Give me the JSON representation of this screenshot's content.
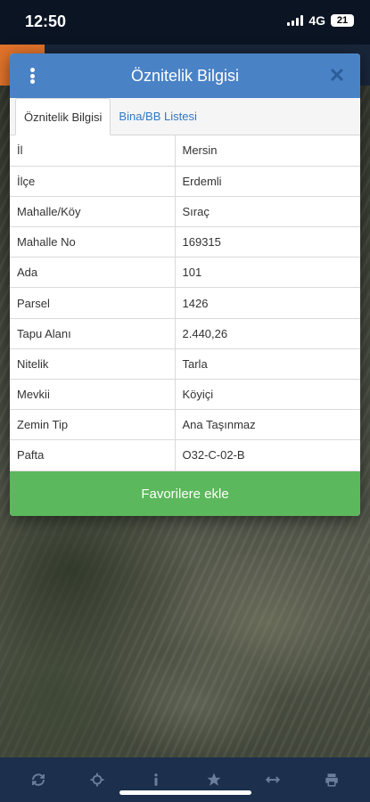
{
  "status": {
    "time": "12:50",
    "network": "4G",
    "battery": "21"
  },
  "modal": {
    "title": "Öznitelik Bilgisi",
    "tabs": [
      {
        "label": "Öznitelik Bilgisi",
        "active": true
      },
      {
        "label": "Bina/BB Listesi",
        "active": false
      }
    ],
    "rows": [
      {
        "key": "İl",
        "value": "Mersin"
      },
      {
        "key": "İlçe",
        "value": "Erdemli"
      },
      {
        "key": "Mahalle/Köy",
        "value": "Sıraç"
      },
      {
        "key": "Mahalle No",
        "value": "169315"
      },
      {
        "key": "Ada",
        "value": "101"
      },
      {
        "key": "Parsel",
        "value": "1426"
      },
      {
        "key": "Tapu Alanı",
        "value": "2.440,26"
      },
      {
        "key": "Nitelik",
        "value": "Tarla"
      },
      {
        "key": "Mevkii",
        "value": "Köyiçi"
      },
      {
        "key": "Zemin Tip",
        "value": "Ana Taşınmaz"
      },
      {
        "key": "Pafta",
        "value": "O32-C-02-B"
      }
    ],
    "favorite_label": "Favorilere ekle"
  },
  "toolbar": {
    "icons": [
      "refresh-icon",
      "crosshair-icon",
      "info-icon",
      "star-icon",
      "measure-icon",
      "print-icon"
    ]
  },
  "colors": {
    "header": "#4a82c6",
    "button": "#5cb85c",
    "toolbar": "#1c2f4d",
    "accent": "#e0732b"
  }
}
